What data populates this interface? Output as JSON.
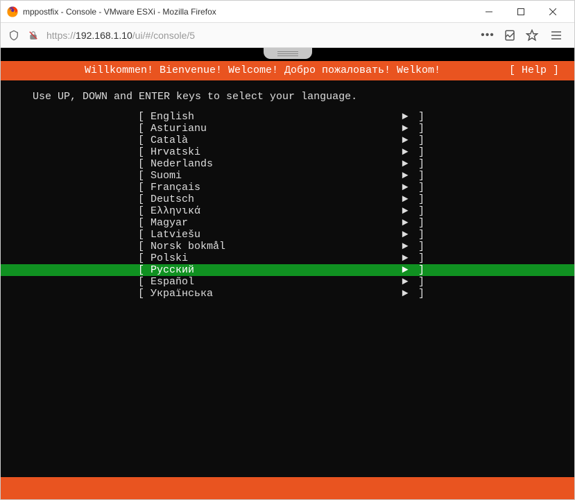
{
  "window": {
    "title": "mppostfix - Console - VMware ESXi - Mozilla Firefox"
  },
  "addressbar": {
    "url_prefix": "https://",
    "url_host": "192.168.1.10",
    "url_path": "/ui/#/console/5"
  },
  "terminal": {
    "welcome_banner": "Willkommen! Bienvenue! Welcome! Добро пожаловать! Welkom!",
    "help_label": "[ Help ]",
    "instruction": "Use UP, DOWN and ENTER keys to select your language.",
    "selected_index": 13,
    "languages": [
      "English",
      "Asturianu",
      "Català",
      "Hrvatski",
      "Nederlands",
      "Suomi",
      "Français",
      "Deutsch",
      "Ελληνικά",
      "Magyar",
      "Latviešu",
      "Norsk bokmål",
      "Polski",
      "Русский",
      "Español",
      "Українська"
    ]
  }
}
